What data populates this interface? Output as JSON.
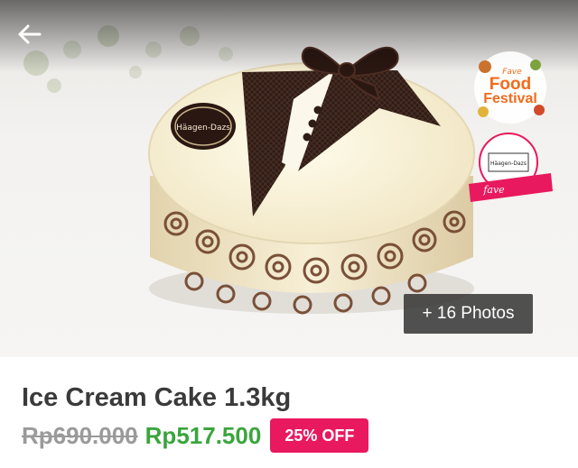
{
  "header": {
    "back_icon": "arrow-left-icon"
  },
  "hero": {
    "photo_subject": "cake-photo",
    "cake_logo_text": "Häagen-Dazs",
    "promo": {
      "line1": "Fave",
      "line2": "Food",
      "line3": "Festival",
      "brand": "fave",
      "logo_text": "Häagen-Dazs"
    },
    "more_photos_label": "+ 16 Photos"
  },
  "deal": {
    "title": "Ice Cream Cake 1.3kg",
    "original_price": "Rp690.000",
    "discounted_price": "Rp517.500",
    "discount_label": "25% OFF"
  },
  "colors": {
    "price_green": "#3aa53c",
    "discount_pink": "#e8195e",
    "promo_orange": "#f26b1d"
  }
}
